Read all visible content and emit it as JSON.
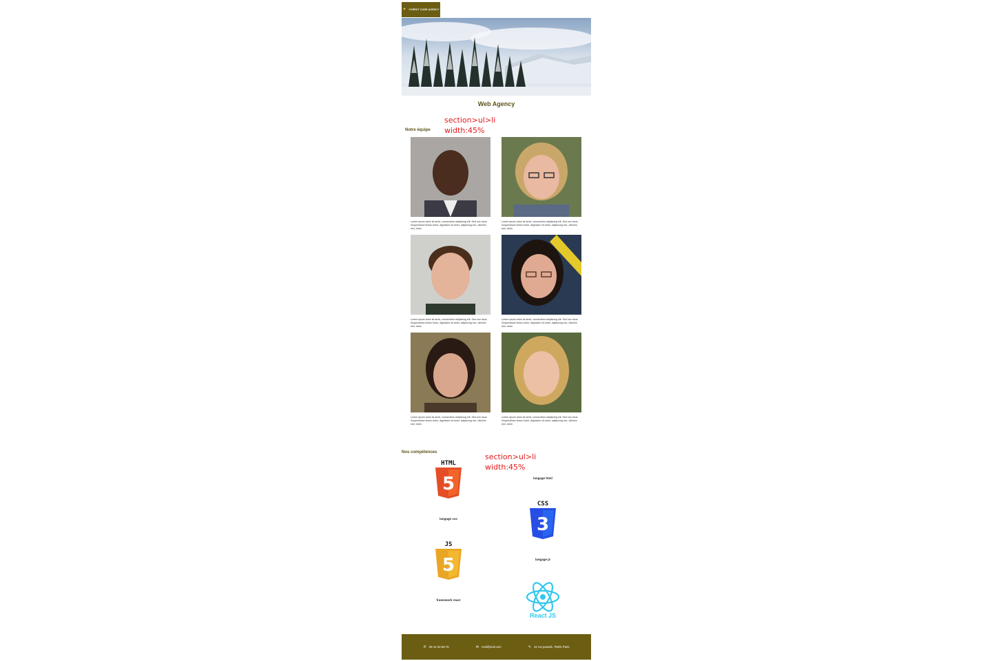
{
  "header": {
    "logo_text": "FOREST CODE AGENCY",
    "logo_icon": "star-icon"
  },
  "site_title": "Web Agency",
  "annotations": [
    {
      "line1": "section>ul>li",
      "line2": "width:45%"
    },
    {
      "line1": "section>ul>li",
      "line2": "width:45%"
    }
  ],
  "team": {
    "title": "Notre équipe",
    "members": [
      {
        "bio": "Lorem ipsum dolor sit amet, consectetur adipiscing elit. Sed non risus. Suspendisse lectus tortor, dignissim sit amet, adipiscing nec, ultricies sed, dolor."
      },
      {
        "bio": "Lorem ipsum dolor sit amet, consectetur adipiscing elit. Sed non risus. Suspendisse lectus tortor, dignissim sit amet, adipiscing nec, ultricies sed, dolor."
      },
      {
        "bio": "Lorem ipsum dolor sit amet, consectetur adipiscing elit. Sed non risus. Suspendisse lectus tortor, dignissim sit amet, adipiscing nec, ultricies sed, dolor."
      },
      {
        "bio": "Lorem ipsum dolor sit amet, consectetur adipiscing elit. Sed non risus. Suspendisse lectus tortor, dignissim sit amet, adipiscing nec, ultricies sed, dolor."
      },
      {
        "bio": "Lorem ipsum dolor sit amet, consectetur adipiscing elit. Sed non risus. Suspendisse lectus tortor, dignissim sit amet, adipiscing nec, ultricies sed, dolor."
      },
      {
        "bio": "Lorem ipsum dolor sit amet, consectetur adipiscing elit. Sed non risus. Suspendisse lectus tortor, dignissim sit amet, adipiscing nec, ultricies sed, dolor."
      }
    ]
  },
  "skills": {
    "title": "Nos compétences",
    "items": [
      {
        "logo_text": "HTML",
        "label": "langage html",
        "icon": "html5-icon"
      },
      {
        "logo_text": "CSS",
        "label": "langage css",
        "icon": "css3-icon"
      },
      {
        "logo_text": "JS",
        "label": "langage js",
        "icon": "js-icon"
      },
      {
        "logo_text": "React JS",
        "label": "framework react",
        "icon": "react-icon"
      }
    ]
  },
  "footer": {
    "phone": "06-12-34-56-78",
    "email": "mail@mail.com",
    "address": "42 rue paradis, 75001 Paris"
  },
  "colors": {
    "brand": "#6b5e12",
    "annotation": "#e3191b",
    "html": "#e44d26",
    "css": "#264de4",
    "js": "#e9a626",
    "react": "#31c7ef"
  }
}
